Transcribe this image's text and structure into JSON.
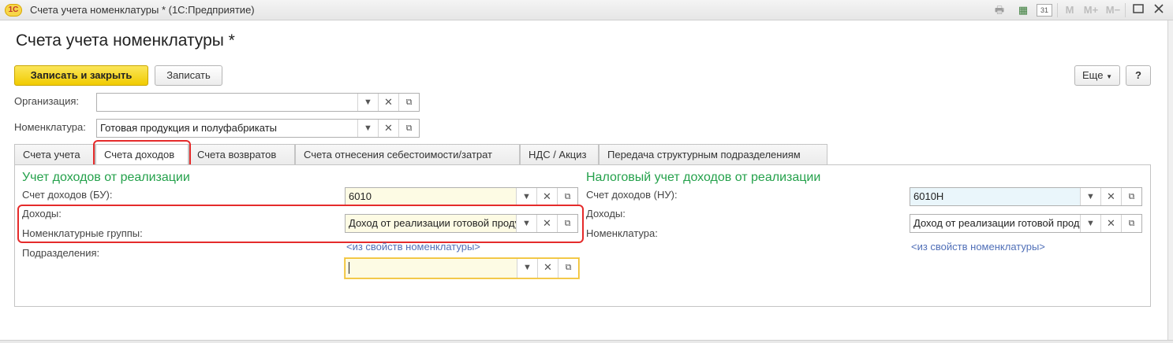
{
  "window": {
    "logo": "1С",
    "title": "Счета учета номенклатуры * (1С:Предприятие)",
    "controls": {
      "m": "M",
      "m_plus": "M+",
      "m_minus": "M−",
      "calendar_day": "31"
    }
  },
  "form": {
    "title": "Счета учета номенклатуры *",
    "save_close_label": "Записать и закрыть",
    "save_label": "Записать",
    "more_label": "Еще",
    "help_label": "?"
  },
  "organization": {
    "label": "Организация:",
    "value": ""
  },
  "nomenclature": {
    "label": "Номенклатура:",
    "value": "Готовая продукция и полуфабрикаты"
  },
  "tabs": [
    {
      "label": "Счета учета",
      "active": false
    },
    {
      "label": "Счета доходов",
      "active": true
    },
    {
      "label": "Счета возвратов",
      "active": false
    },
    {
      "label": "Счета отнесения себестоимости/затрат",
      "active": false
    },
    {
      "label": "НДС / Акциз",
      "active": false
    },
    {
      "label": "Передача структурным подразделениям",
      "active": false
    }
  ],
  "left": {
    "title": "Учет доходов от реализации",
    "account_label": "Счет доходов (БУ):",
    "account_value": "6010",
    "income_label": "Доходы:",
    "income_value": "Доход от реализации готовой продукции",
    "groups_label": "Номенклатурные группы:",
    "from_props_link": "<из свойств номенклатуры>",
    "division_label": "Подразделения:",
    "division_value": ""
  },
  "right": {
    "title": "Налоговый учет доходов от реализации",
    "account_label": "Счет доходов (НУ):",
    "account_value": "6010Н",
    "income_label": "Доходы:",
    "income_value": "Доход от реализации готовой продукции",
    "nomenclature_label": "Номенклатура:",
    "from_props_link": "<из свойств номенклатуры>"
  },
  "colors": {
    "accent_green": "#24a14b",
    "primary_button": "#f1cb00",
    "highlight_red": "#e52b2b",
    "link_blue": "#5170b8"
  }
}
